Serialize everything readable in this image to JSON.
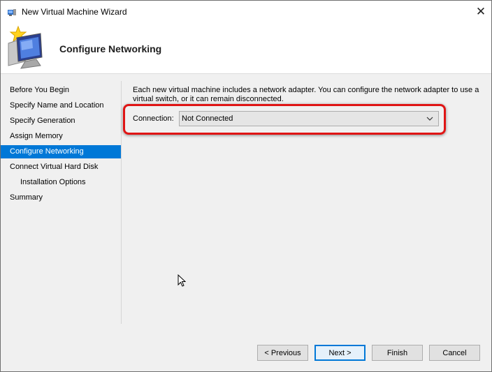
{
  "window": {
    "title": "New Virtual Machine Wizard",
    "close_glyph": "✕"
  },
  "header": {
    "title": "Configure Networking",
    "icon": "computer-star-icon"
  },
  "nav": {
    "items": [
      {
        "label": "Before You Begin"
      },
      {
        "label": "Specify Name and Location"
      },
      {
        "label": "Specify Generation"
      },
      {
        "label": "Assign Memory"
      },
      {
        "label": "Configure Networking"
      },
      {
        "label": "Connect Virtual Hard Disk"
      },
      {
        "label": "Installation Options"
      },
      {
        "label": "Summary"
      }
    ],
    "active_index": 4
  },
  "content": {
    "description": "Each new virtual machine includes a network adapter. You can configure the network adapter to use a virtual switch, or it can remain disconnected.",
    "connection_label": "Connection:",
    "connection_value": "Not Connected"
  },
  "buttons": {
    "previous": "< Previous",
    "next": "Next >",
    "finish": "Finish",
    "cancel": "Cancel"
  },
  "colors": {
    "accent": "#0078d7",
    "highlight": "#e01515"
  }
}
